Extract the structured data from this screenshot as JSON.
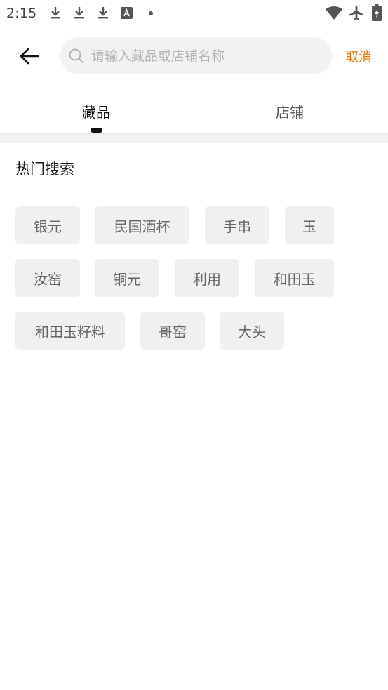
{
  "status_bar": {
    "time": "2:15",
    "icons": [
      "download-icon",
      "download-icon",
      "download-icon",
      "text-a-icon",
      "dot-icon",
      "wifi-icon",
      "airplane-mode-icon",
      "battery-charging-icon"
    ]
  },
  "header": {
    "search_placeholder": "请输入藏品或店铺名称",
    "search_value": "",
    "cancel_label": "取消"
  },
  "tabs": [
    {
      "label": "藏品",
      "active": true
    },
    {
      "label": "店铺",
      "active": false
    }
  ],
  "hot_search": {
    "title": "热门搜索",
    "tags": [
      "银元",
      "民国酒杯",
      "手串",
      "玉",
      "汝窑",
      "铜元",
      "利用",
      "和田玉",
      "和田玉籽料",
      "哥窑",
      "大头"
    ]
  },
  "colors": {
    "accent": "#f07a12",
    "tag_bg": "#f0f0f0",
    "search_bg": "#f2f2f2"
  }
}
